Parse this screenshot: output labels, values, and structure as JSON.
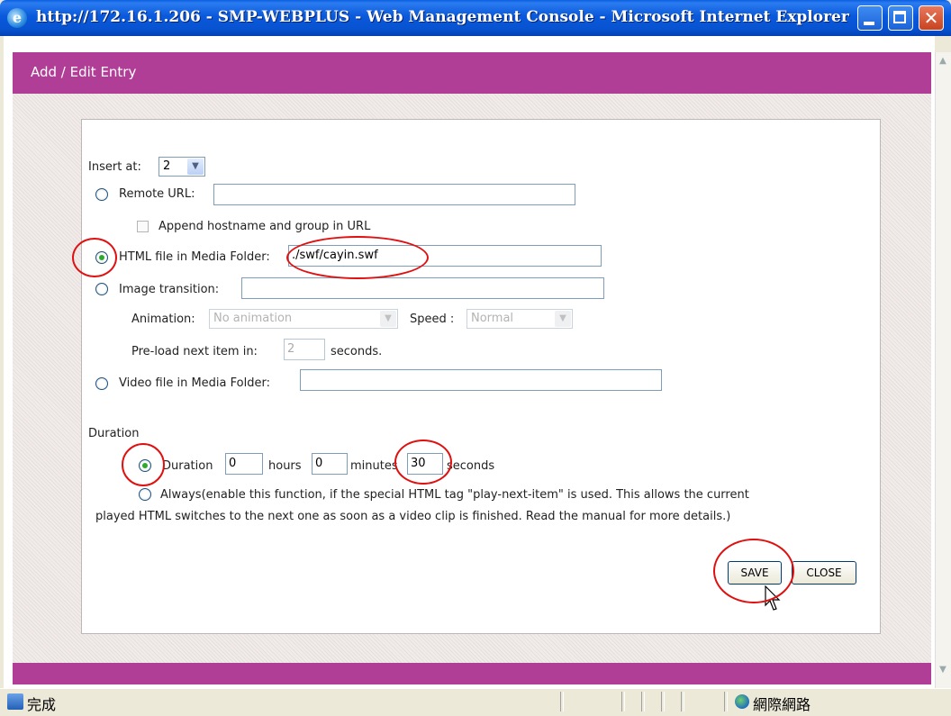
{
  "window": {
    "title": "http://172.16.1.206 - SMP-WEBPLUS - Web Management Console - Microsoft Internet Explorer",
    "ie_icon": "e"
  },
  "header": {
    "title": "Add / Edit Entry"
  },
  "form": {
    "insert_at_label": "Insert at:",
    "insert_at_value": "2",
    "remote_url_label": "Remote URL:",
    "remote_url_value": "",
    "append_hostname_label": "Append hostname and group in URL",
    "html_file_label": "HTML file in Media Folder:",
    "html_file_value": "./swf/cayin.swf",
    "image_transition_label": "Image transition:",
    "image_transition_value": "",
    "animation_label": "Animation:",
    "animation_value": "No animation",
    "speed_label": "Speed :",
    "speed_value": "Normal",
    "preload_label": "Pre-load next item in:",
    "preload_value": "2",
    "preload_unit": "seconds.",
    "video_file_label": "Video file in Media Folder:",
    "video_file_value": "",
    "duration_section_label": "Duration",
    "duration_option_label": "Duration",
    "hours_value": "0",
    "hours_label": "hours",
    "minutes_value": "0",
    "minutes_label": "minutes",
    "seconds_value": "30",
    "seconds_label": "seconds",
    "always_label_line1": "Always(enable this function, if the special HTML tag \"play-next-item\" is used. This allows the current",
    "always_label_line2": "played HTML switches to the next one as soon as a video clip is finished. Read the manual for more details.)",
    "save_label": "SAVE",
    "close_label": "CLOSE",
    "selected_content_type": "html_file",
    "selected_duration_type": "duration"
  },
  "statusbar": {
    "status_text": "完成",
    "zone_text": "網際網路"
  },
  "colors": {
    "accent": "#b03e96",
    "annotation": "#e01010",
    "titlebar": "#0a59dc"
  }
}
